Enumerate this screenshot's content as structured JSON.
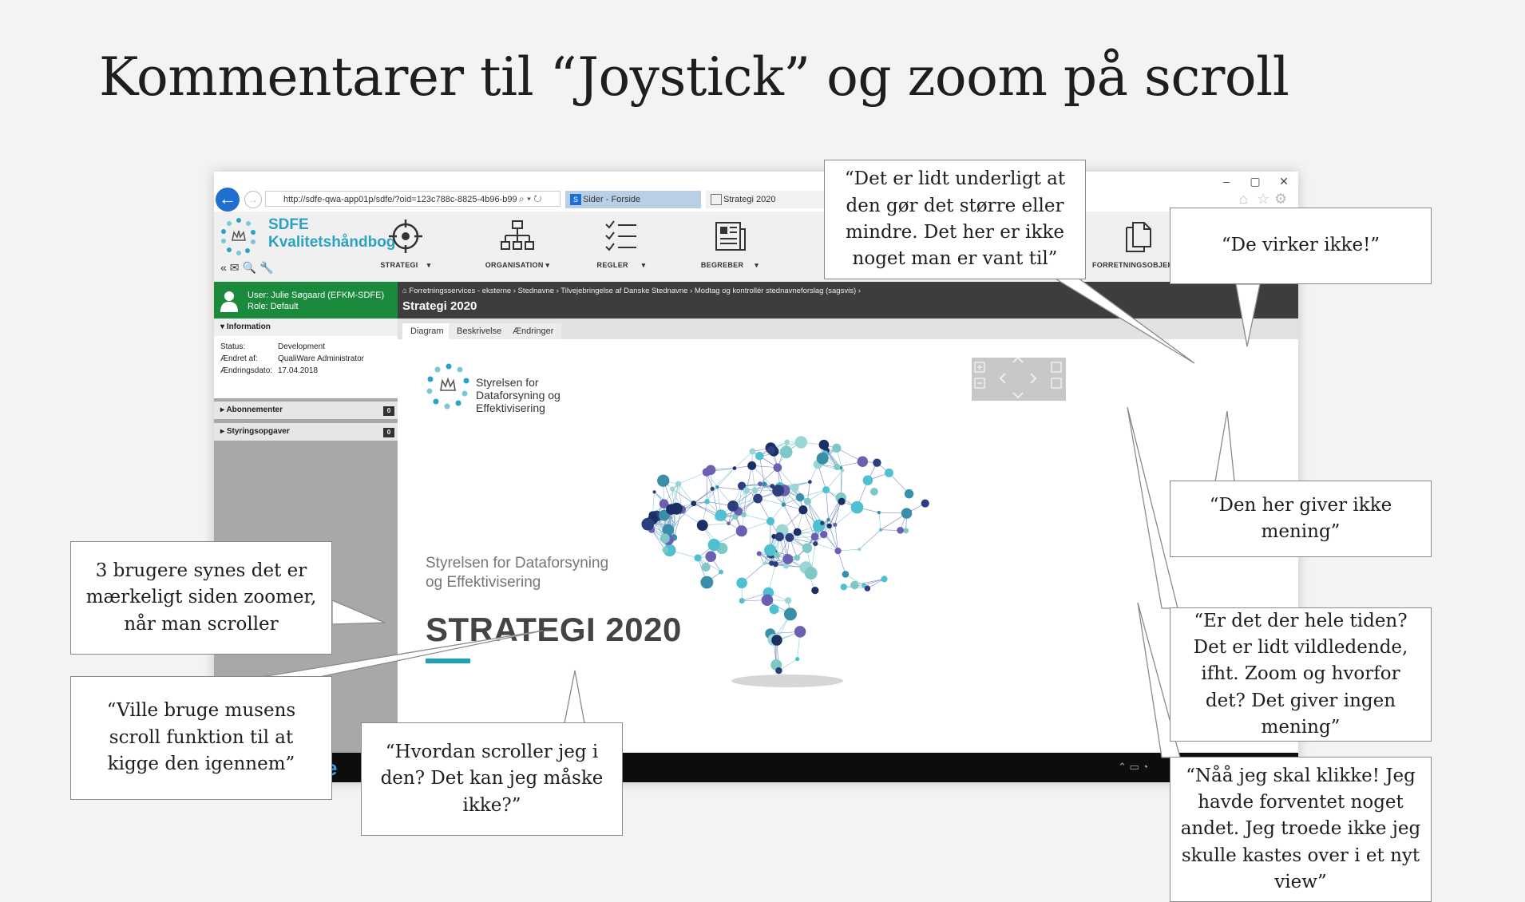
{
  "slide": {
    "title": "Kommentarer til “Joystick” og zoom på scroll"
  },
  "browser": {
    "url": "http://sdfe-qwa-app01p/sdfe/?oid=123c788c-8825-4b96-b99",
    "tabs": [
      "Sider - Forside",
      "Strategi 2020"
    ],
    "window_controls": [
      "–",
      "▢",
      "✕"
    ]
  },
  "app": {
    "brand_line1": "SDFE",
    "brand_line2": "Kvalitetshåndbog",
    "nav": [
      "STRATEGI",
      "ORGANISATION",
      "REGLER",
      "BEGREBER",
      "FORRETNINGSOBJEKTER"
    ],
    "user": {
      "line1": "User: Julie Søgaard (EFKM-SDFE)",
      "line2": "Role: Default"
    },
    "info": {
      "header": "Information",
      "rows": [
        {
          "key": "Status:",
          "value": "Development"
        },
        {
          "key": "Ændret af:",
          "value": "QualiWare Administrator"
        },
        {
          "key": "Ændringsdato:",
          "value": "17.04.2018"
        }
      ]
    },
    "sections": [
      {
        "label": "Abonnementer",
        "count": "0"
      },
      {
        "label": "Styringsopgaver",
        "count": "0"
      }
    ],
    "breadcrumb": "Forretningsservices - eksterne › Stednavne › Tilvejebringelse af Danske Stednavne › Modtag og kontrollér stednavneforslag (sagsvis) ›",
    "page_title": "Strategi 2020",
    "content_tabs": [
      "Diagram",
      "Beskrivelse",
      "Ændringer"
    ],
    "diagram": {
      "agency_logo_lines": [
        "Styrelsen for",
        "Dataforsyning og",
        "Effektivisering"
      ],
      "subtitle_lines": [
        "Styrelsen for Dataforsyning",
        "og Effektivisering"
      ],
      "big_title": "STRATEGI 2020",
      "accent_color": "#1ba3b5"
    }
  },
  "callouts": [
    "“Det er lidt underligt at den gør det større eller mindre. Det her er ikke noget man er vant til”",
    "“De virker ikke!”",
    "“Den her giver ikke mening”",
    "3 brugere synes det er mærkeligt siden zoomer, når man scroller",
    "“Ville bruge musens scroll funktion til at kigge den igennem”",
    "“Hvordan scroller jeg i den? Det kan jeg måske ikke?”",
    "“Er det der hele tiden? Det er lidt vildledende, ifht. Zoom og hvorfor det? Det giver ingen mening”",
    "“Nåå jeg skal klikke! Jeg havde forventet noget andet. Jeg troede ikke jeg skulle kastes over i et nyt view”"
  ]
}
